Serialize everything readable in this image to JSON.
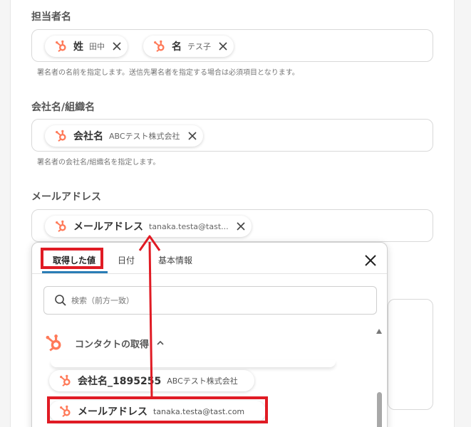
{
  "fields": {
    "contact_name": {
      "label": "担当者名",
      "chips": [
        {
          "label": "姓",
          "value": "田中"
        },
        {
          "label": "名",
          "value": "テス子"
        }
      ],
      "hint": "署名者の名前を指定します。送信先署名者を指定する場合は必須項目となります。"
    },
    "company": {
      "label": "会社名/組織名",
      "chips": [
        {
          "label": "会社名",
          "value": "ABCテスト株式会社"
        }
      ],
      "hint": "署名者の会社名/組織名を指定します。"
    },
    "email": {
      "label": "メールアドレス",
      "chips": [
        {
          "label": "メールアドレス",
          "value": "tanaka.testa@tast..."
        }
      ]
    }
  },
  "popup": {
    "tabs": [
      "取得した値",
      "日付",
      "基本情報"
    ],
    "search_placeholder": "検索（前方一致）",
    "section_title": "コンタクトの取得",
    "items": [
      {
        "label": "会社名_1895255",
        "value": "ABCテスト株式会社"
      },
      {
        "label": "メールアドレス",
        "value": "tanaka.testa@tast.com"
      }
    ]
  },
  "colors": {
    "hubspot": "#ff7a59",
    "highlight": "#e01b24",
    "tab_underline": "#2a7db6"
  },
  "icons": [
    "hubspot-icon",
    "close-icon",
    "search-icon",
    "chevron-up-icon",
    "scroll-up-icon"
  ]
}
